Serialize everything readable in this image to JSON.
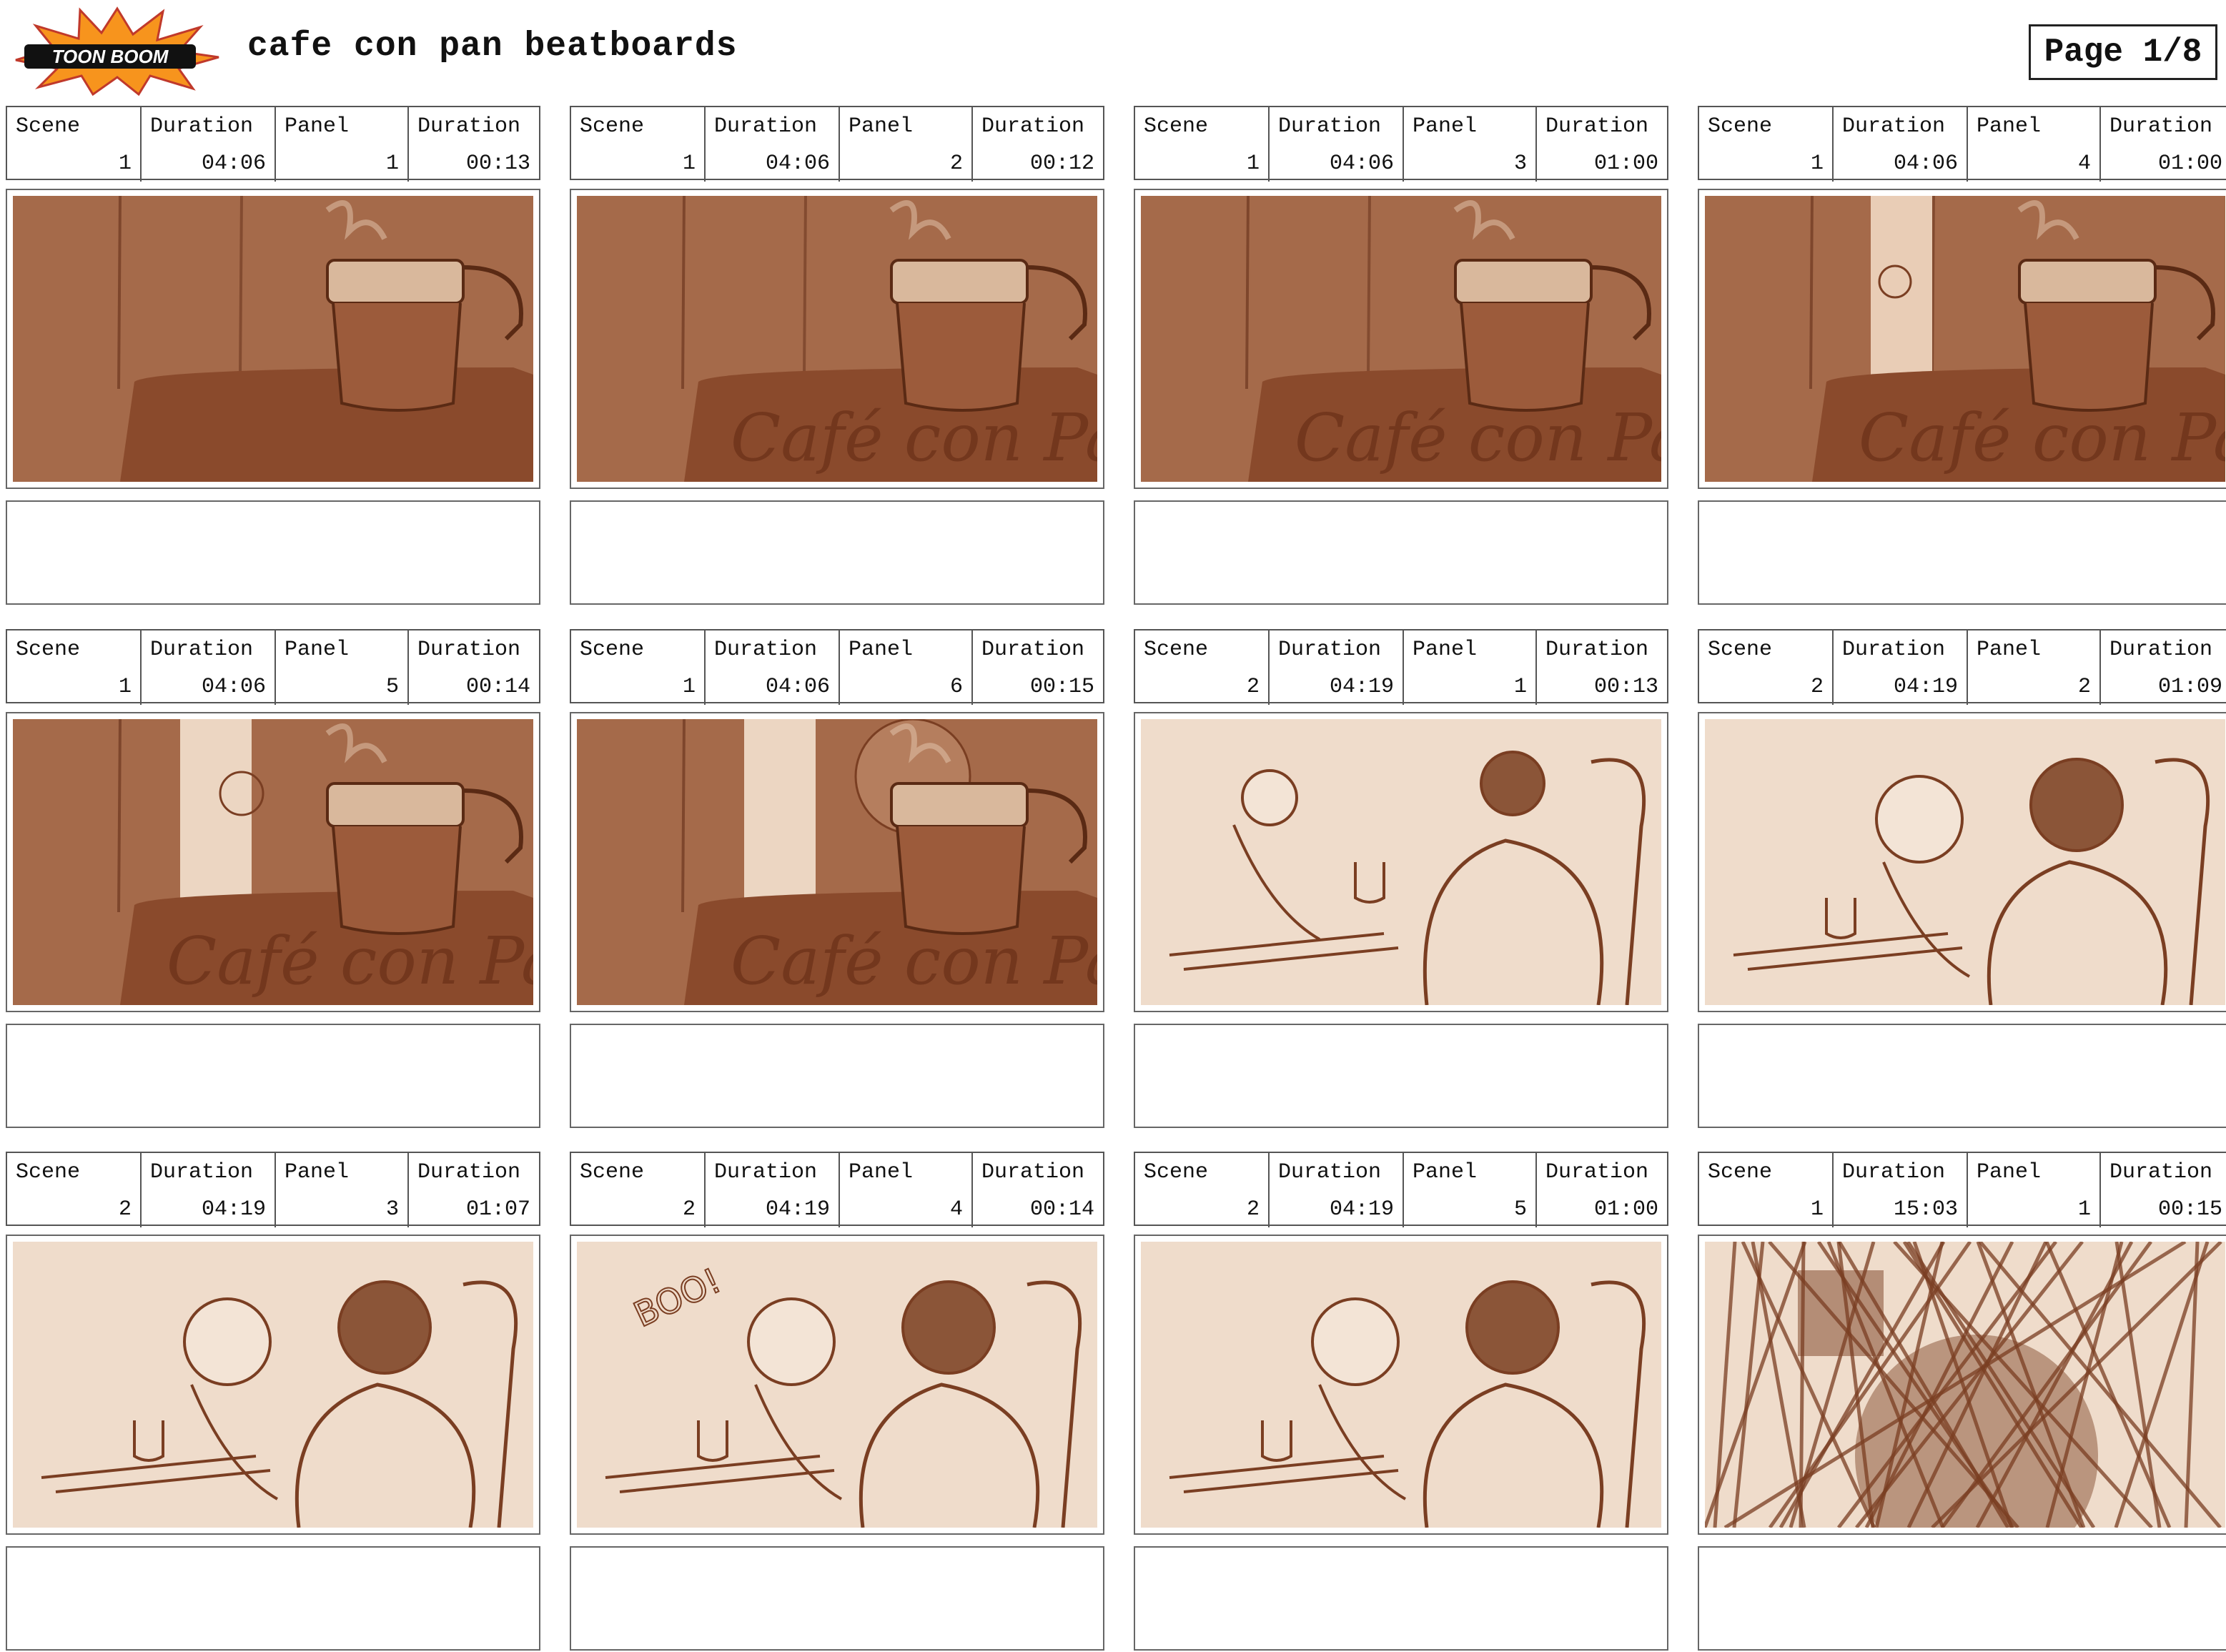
{
  "header": {
    "logo_text": "TOON BOOM",
    "title": "cafe con pan beatboards",
    "page": "Page 1/8"
  },
  "labels": {
    "scene": "Scene",
    "duration": "Duration",
    "panel": "Panel"
  },
  "colors": {
    "sepia_dark": "#8a4a2c",
    "sepia_mid": "#a56a4a",
    "sketch_bg": "#efdccb",
    "ink": "#7a3e22",
    "logo_orange": "#f7941d"
  },
  "panels": [
    {
      "scene": "1",
      "scene_duration": "04:06",
      "panel": "1",
      "panel_duration": "00:13",
      "art": "cup",
      "art_text": ""
    },
    {
      "scene": "1",
      "scene_duration": "04:06",
      "panel": "2",
      "panel_duration": "00:12",
      "art": "cup",
      "art_text": "Café con Pan"
    },
    {
      "scene": "1",
      "scene_duration": "04:06",
      "panel": "3",
      "panel_duration": "01:00",
      "art": "cup",
      "art_text": "Café con Pan"
    },
    {
      "scene": "1",
      "scene_duration": "04:06",
      "panel": "4",
      "panel_duration": "01:00",
      "art": "cup-girl",
      "art_text": "Café con Pan"
    },
    {
      "scene": "1",
      "scene_duration": "04:06",
      "panel": "5",
      "panel_duration": "00:14",
      "art": "cup-door",
      "art_text": "Café con Pan"
    },
    {
      "scene": "1",
      "scene_duration": "04:06",
      "panel": "6",
      "panel_duration": "00:15",
      "art": "cup-face",
      "art_text": "Café con Pan"
    },
    {
      "scene": "2",
      "scene_duration": "04:19",
      "panel": "1",
      "panel_duration": "00:13",
      "art": "sketch-wide",
      "art_text": ""
    },
    {
      "scene": "2",
      "scene_duration": "04:19",
      "panel": "2",
      "panel_duration": "01:09",
      "art": "sketch-close",
      "art_text": ""
    },
    {
      "scene": "2",
      "scene_duration": "04:19",
      "panel": "3",
      "panel_duration": "01:07",
      "art": "sketch-close",
      "art_text": ""
    },
    {
      "scene": "2",
      "scene_duration": "04:19",
      "panel": "4",
      "panel_duration": "00:14",
      "art": "sketch-boo",
      "art_text": "BOO!"
    },
    {
      "scene": "2",
      "scene_duration": "04:19",
      "panel": "5",
      "panel_duration": "01:00",
      "art": "sketch-boo",
      "art_text": ""
    },
    {
      "scene": "1",
      "scene_duration": "15:03",
      "panel": "1",
      "panel_duration": "00:15",
      "art": "scribble",
      "art_text": ""
    }
  ]
}
